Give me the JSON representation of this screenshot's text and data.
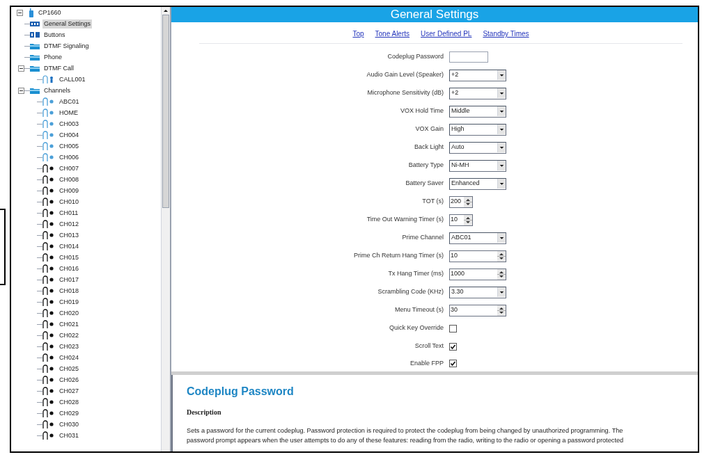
{
  "tree": {
    "label": "CP1660",
    "kind": "device",
    "selected": false,
    "expanded": true,
    "children": [
      {
        "label": "General Settings",
        "kind": "grid",
        "selected": true
      },
      {
        "label": "Buttons",
        "kind": "keys",
        "selected": false
      },
      {
        "label": "DTMF Signaling",
        "kind": "folder",
        "selected": false
      },
      {
        "label": "Phone",
        "kind": "folder",
        "selected": false
      },
      {
        "label": "DTMF Call",
        "kind": "folder",
        "selected": false,
        "expanded": true,
        "children": [
          {
            "label": "CALL001",
            "kind": "contact",
            "selected": false
          }
        ]
      },
      {
        "label": "Channels",
        "kind": "folder",
        "selected": false,
        "expanded": true,
        "children": [
          {
            "label": "ABC01",
            "kind": "channel",
            "selected": false,
            "color": "#4a9fd8"
          },
          {
            "label": "HOME",
            "kind": "channel",
            "selected": false,
            "color": "#4a9fd8"
          },
          {
            "label": "CH003",
            "kind": "channel",
            "selected": false,
            "color": "#4a9fd8"
          },
          {
            "label": "CH004",
            "kind": "channel",
            "selected": false,
            "color": "#4a9fd8"
          },
          {
            "label": "CH005",
            "kind": "channel",
            "selected": false,
            "color": "#4a9fd8"
          },
          {
            "label": "CH006",
            "kind": "channel",
            "selected": false,
            "color": "#4a9fd8"
          },
          {
            "label": "CH007",
            "kind": "channel",
            "selected": false,
            "color": "#111111"
          },
          {
            "label": "CH008",
            "kind": "channel",
            "selected": false,
            "color": "#111111"
          },
          {
            "label": "CH009",
            "kind": "channel",
            "selected": false,
            "color": "#111111"
          },
          {
            "label": "CH010",
            "kind": "channel",
            "selected": false,
            "color": "#111111"
          },
          {
            "label": "CH011",
            "kind": "channel",
            "selected": false,
            "color": "#111111"
          },
          {
            "label": "CH012",
            "kind": "channel",
            "selected": false,
            "color": "#111111"
          },
          {
            "label": "CH013",
            "kind": "channel",
            "selected": false,
            "color": "#111111"
          },
          {
            "label": "CH014",
            "kind": "channel",
            "selected": false,
            "color": "#111111"
          },
          {
            "label": "CH015",
            "kind": "channel",
            "selected": false,
            "color": "#111111"
          },
          {
            "label": "CH016",
            "kind": "channel",
            "selected": false,
            "color": "#111111"
          },
          {
            "label": "CH017",
            "kind": "channel",
            "selected": false,
            "color": "#111111"
          },
          {
            "label": "CH018",
            "kind": "channel",
            "selected": false,
            "color": "#111111"
          },
          {
            "label": "CH019",
            "kind": "channel",
            "selected": false,
            "color": "#111111"
          },
          {
            "label": "CH020",
            "kind": "channel",
            "selected": false,
            "color": "#111111"
          },
          {
            "label": "CH021",
            "kind": "channel",
            "selected": false,
            "color": "#111111"
          },
          {
            "label": "CH022",
            "kind": "channel",
            "selected": false,
            "color": "#111111"
          },
          {
            "label": "CH023",
            "kind": "channel",
            "selected": false,
            "color": "#111111"
          },
          {
            "label": "CH024",
            "kind": "channel",
            "selected": false,
            "color": "#111111"
          },
          {
            "label": "CH025",
            "kind": "channel",
            "selected": false,
            "color": "#111111"
          },
          {
            "label": "CH026",
            "kind": "channel",
            "selected": false,
            "color": "#111111"
          },
          {
            "label": "CH027",
            "kind": "channel",
            "selected": false,
            "color": "#111111"
          },
          {
            "label": "CH028",
            "kind": "channel",
            "selected": false,
            "color": "#111111"
          },
          {
            "label": "CH029",
            "kind": "channel",
            "selected": false,
            "color": "#111111"
          },
          {
            "label": "CH030",
            "kind": "channel",
            "selected": false,
            "color": "#111111"
          },
          {
            "label": "CH031",
            "kind": "channel",
            "selected": false,
            "color": "#111111"
          }
        ]
      }
    ]
  },
  "header": {
    "title": "General Settings"
  },
  "nav_links": [
    "Top",
    "Tone Alerts",
    "User Defined PL",
    "Standby Times"
  ],
  "fields": [
    {
      "label": "Codeplug Password",
      "kind": "text"
    },
    {
      "label": "Audio Gain Level (Speaker)",
      "kind": "select",
      "value": "+2"
    },
    {
      "label": "Microphone Sensitivity (dB)",
      "kind": "select",
      "value": "+2"
    },
    {
      "label": "VOX Hold Time",
      "kind": "select",
      "value": "Middle"
    },
    {
      "label": "VOX Gain",
      "kind": "select",
      "value": "High"
    },
    {
      "label": "Back Light",
      "kind": "select",
      "value": "Auto"
    },
    {
      "label": "Battery Type",
      "kind": "select",
      "value": "Ni-MH"
    },
    {
      "label": "Battery Saver",
      "kind": "select",
      "value": "Enhanced"
    },
    {
      "label": "TOT (s)",
      "kind": "spin",
      "wide": false,
      "value": "200"
    },
    {
      "label": "Time Out Warning Timer (s)",
      "kind": "spin",
      "wide": false,
      "value": "10"
    },
    {
      "label": "Prime Channel",
      "kind": "select",
      "value": "ABC01"
    },
    {
      "label": "Prime Ch Return Hang Timer (s)",
      "kind": "spin",
      "wide": true,
      "value": "10"
    },
    {
      "label": "Tx Hang Timer (ms)",
      "kind": "spin",
      "wide": true,
      "value": "1000"
    },
    {
      "label": "Scrambling Code (KHz)",
      "kind": "select",
      "value": "3.30"
    },
    {
      "label": "Menu Timeout (s)",
      "kind": "spin",
      "wide": true,
      "value": "30"
    },
    {
      "label": "Quick Key Override",
      "kind": "checkbox",
      "checked": false
    },
    {
      "label": "Scroll Text",
      "kind": "checkbox",
      "checked": true
    },
    {
      "label": "Enable FPP",
      "kind": "checkbox",
      "checked": true
    }
  ],
  "help": {
    "title": "Codeplug Password",
    "heading": "Description",
    "lines": [
      "Sets a password for the current codeplug. Password protection is required to protect the codeplug from being changed by unauthorized programming. The",
      "password prompt appears when the user attempts to do any of these features: reading from the radio, writing to the radio or opening a password protected"
    ]
  }
}
